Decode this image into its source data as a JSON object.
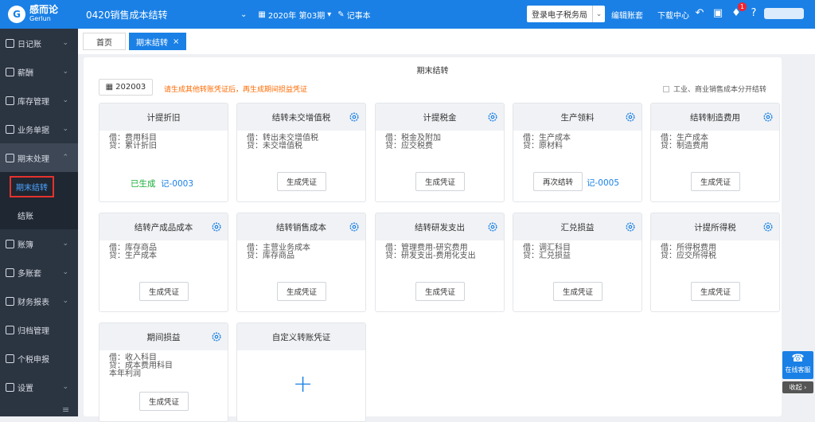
{
  "header": {
    "logo_mark": "G",
    "logo_cn": "感而论",
    "logo_en": "Gerlun",
    "company": "0420销售成本结转",
    "period": "2020年 第03期",
    "notes": "记事本",
    "tax_bureau": "登录电子税务局",
    "edit_account": "编辑账套",
    "download_center": "下载中心",
    "notification_count": "1"
  },
  "sidebar": {
    "items": [
      {
        "label": "日记账"
      },
      {
        "label": "薪酬"
      },
      {
        "label": "库存管理"
      },
      {
        "label": "业务单据"
      },
      {
        "label": "期末处理"
      },
      {
        "label": "账簿"
      },
      {
        "label": "多账套"
      },
      {
        "label": "财务报表"
      },
      {
        "label": "归档管理"
      },
      {
        "label": "个税申报"
      },
      {
        "label": "设置"
      }
    ],
    "sub_items": [
      {
        "label": "期末结转"
      },
      {
        "label": "结账"
      }
    ]
  },
  "tabs": {
    "home": "首页",
    "current": "期末结转",
    "close": "×"
  },
  "main": {
    "title": "期末结转",
    "period": "202003",
    "hint": "请生成其他转账凭证后，再生成期间损益凭证",
    "checkbox_label": "工业、商业销售成本分开结转"
  },
  "cards": [
    {
      "title": "计提折旧",
      "debit": "借：费用科目",
      "credit": "贷：累计折旧",
      "status": "已生成",
      "voucher": "记-0003"
    },
    {
      "title": "结转未交增值税",
      "debit": "借：转出未交增值税",
      "credit": "贷：未交增值税",
      "button": "生成凭证"
    },
    {
      "title": "计提税金",
      "debit": "借：税金及附加",
      "credit": "贷：应交税费",
      "button": "生成凭证"
    },
    {
      "title": "生产领料",
      "debit": "借：生产成本",
      "credit": "贷：原材料",
      "button": "再次结转",
      "voucher": "记-0005"
    },
    {
      "title": "结转制造费用",
      "debit": "借：生产成本",
      "credit": "贷：制造费用",
      "button": "生成凭证"
    },
    {
      "title": "结转产成品成本",
      "debit": "借：库存商品",
      "credit": "贷：生产成本",
      "button": "生成凭证"
    },
    {
      "title": "结转销售成本",
      "debit": "借：主营业务成本",
      "credit": "贷：库存商品",
      "button": "生成凭证"
    },
    {
      "title": "结转研发支出",
      "debit": "借：管理费用-研究费用",
      "credit": "贷：研发支出-费用化支出",
      "button": "生成凭证"
    },
    {
      "title": "汇兑损益",
      "debit": "借：调汇科目",
      "credit": "贷：汇兑损益",
      "button": "生成凭证"
    },
    {
      "title": "计提所得税",
      "debit": "借：所得税费用",
      "credit": "贷：应交所得税",
      "button": "生成凭证"
    },
    {
      "title": "期间损益",
      "debit": "借：收入科目",
      "credit": "贷：成本费用科目",
      "extra": "本年利润",
      "button": "生成凭证"
    },
    {
      "title": "自定义转账凭证",
      "plus": "+"
    }
  ],
  "float": {
    "online_service": "在线客服",
    "collapse": "收起"
  },
  "colors": {
    "primary": "#1a80e6",
    "sidebar": "#2b3441",
    "warning": "#ff6a00",
    "success": "#1aad3a",
    "danger": "#f5222d"
  }
}
